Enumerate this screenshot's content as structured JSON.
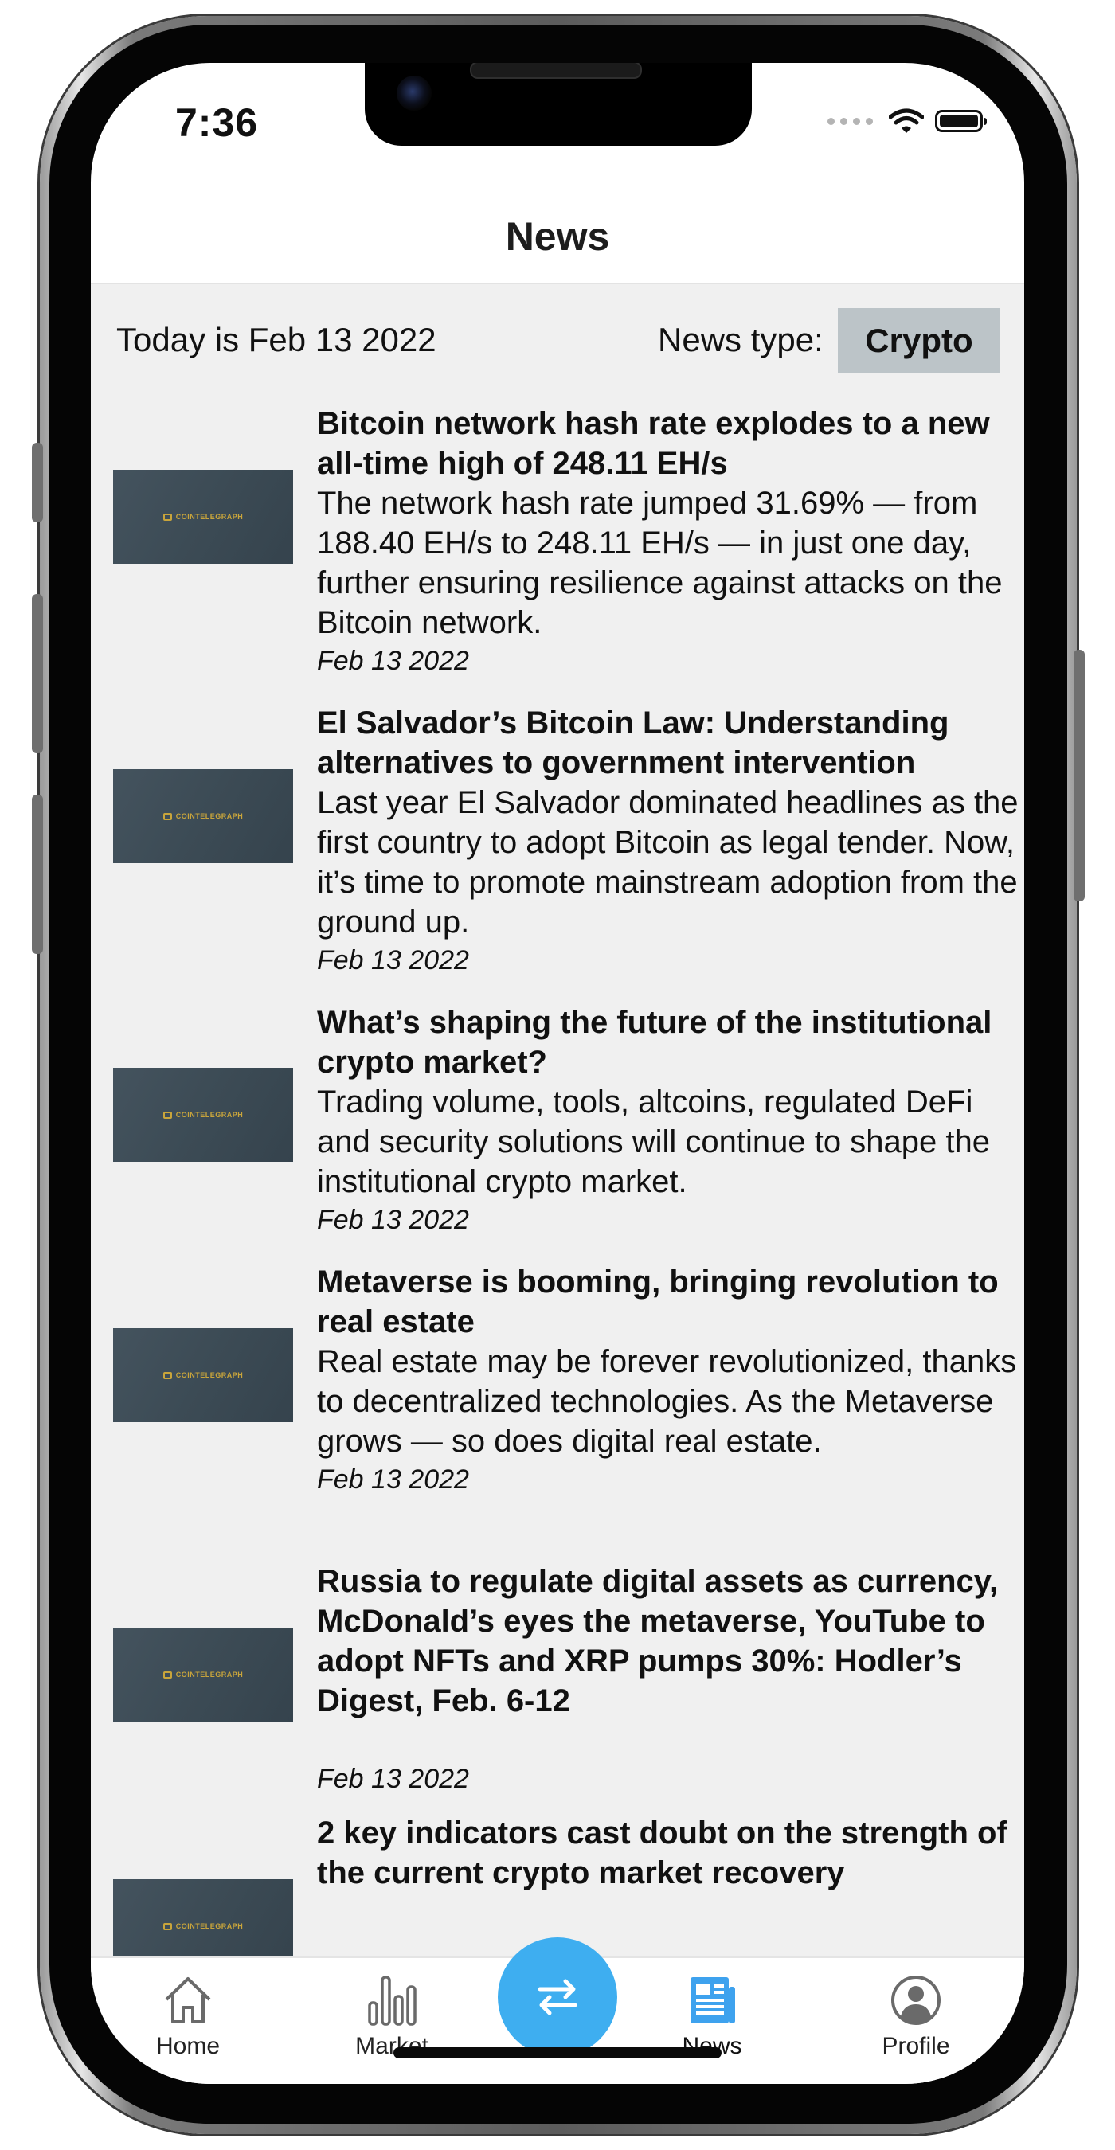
{
  "status_bar": {
    "time": "7:36"
  },
  "header": {
    "title": "News"
  },
  "info": {
    "today": "Today is Feb 13 2022",
    "news_type_label": "News type:",
    "news_type_value": "Crypto"
  },
  "thumbnail_brand": "COINTELEGRAPH",
  "news": [
    {
      "title": "Bitcoin network hash rate explodes to a new all-time high of 248.11 EH/s",
      "description": "The network hash rate jumped 31.69% — from 188.40 EH/s to 248.11 EH/s — in just one day, further ensuring resilience against attacks on the Bitcoin network.",
      "date": "Feb 13 2022"
    },
    {
      "title": "El Salvador’s Bitcoin Law: Understanding alternatives to government intervention",
      "description": "Last year El Salvador dominated headlines as the first country to adopt Bitcoin as legal tender. Now, it’s time to promote mainstream adoption from the ground up.",
      "date": "Feb 13 2022"
    },
    {
      "title": "What’s shaping the future of the institutional crypto market?",
      "description": "Trading volume, tools, altcoins, regulated DeFi and security solutions will continue to shape the institutional crypto market.",
      "date": "Feb 13 2022"
    },
    {
      "title": "Metaverse is booming, bringing revolution to real estate",
      "description": "Real estate may be forever revolutionized, thanks to decentralized technologies. As the Metaverse grows — so does digital real estate.",
      "date": "Feb 13 2022"
    },
    {
      "title": "Russia to regulate digital assets as currency, McDonald’s eyes the metaverse, YouTube to adopt NFTs and XRP pumps 30%: Hodler’s Digest, Feb. 6-12",
      "description": "",
      "date": "Feb 13 2022"
    },
    {
      "title": "2 key indicators cast doubt on the strength of the current crypto market recovery",
      "description": "",
      "date": ""
    }
  ],
  "tabs": {
    "home": {
      "label": "Home",
      "icon": "home-icon"
    },
    "market": {
      "label": "Market",
      "icon": "bar-chart-icon"
    },
    "exchange": {
      "icon": "swap-arrows-icon"
    },
    "news": {
      "label": "News",
      "icon": "newspaper-icon"
    },
    "profile": {
      "label": "Profile",
      "icon": "user-circle-icon"
    }
  },
  "colors": {
    "accent": "#3eaef0",
    "news_type_button": "#bcc4c8",
    "content_background": "#f0f0f0",
    "active_tab_icon": "#3ea2ee",
    "inactive_tab_icon": "#6a6a6a"
  }
}
